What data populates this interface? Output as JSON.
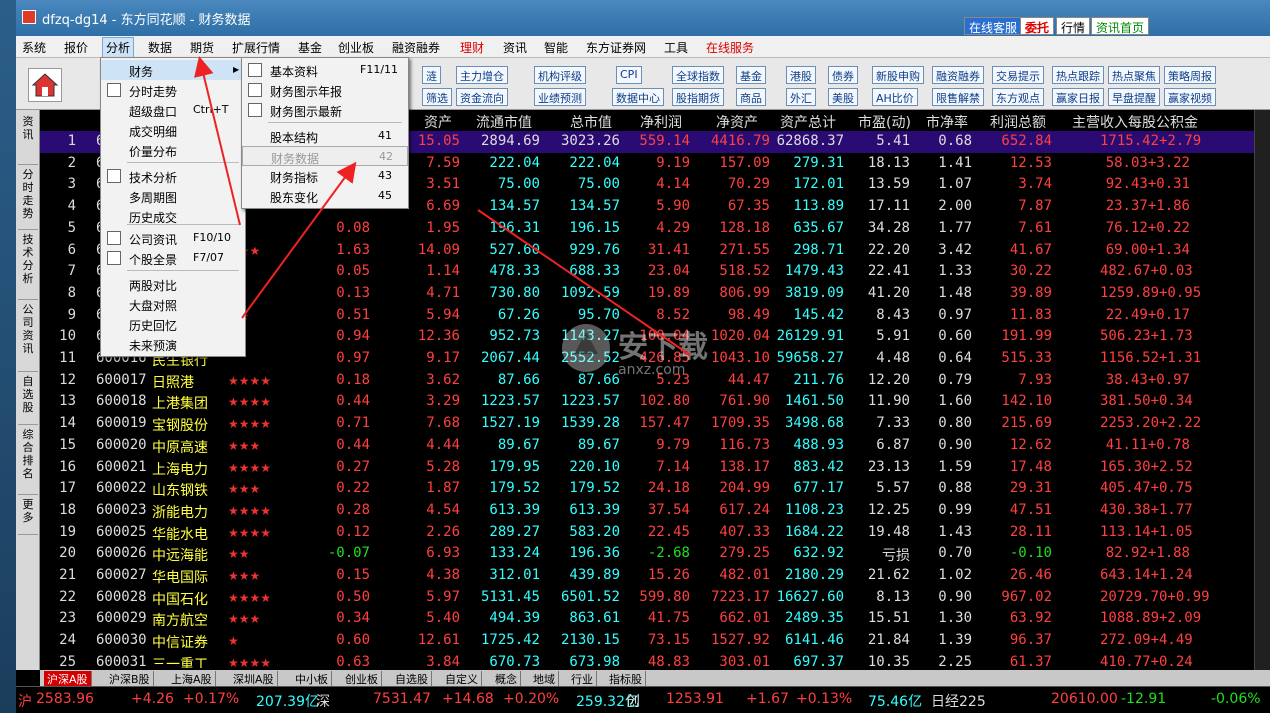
{
  "window": {
    "title": "dfzq-dg14 - 东方同花顺 - 财务数据"
  },
  "titlebar_buttons": {
    "kefu": "在线客服",
    "weituo": "委托",
    "hangqing": "行情",
    "home": "资讯首页"
  },
  "menubar": {
    "items": [
      "系统",
      "报价",
      "分析",
      "数据",
      "期货",
      "扩展行情",
      "基金",
      "创业板",
      "融资融券",
      "理财",
      "资讯",
      "智能",
      "东方证券网",
      "工具",
      "在线服务"
    ]
  },
  "toolbar": {
    "btns": [
      "涟",
      "筛选",
      "主力增仓",
      "机构评级",
      "CPI",
      "数据中心",
      "全球指数",
      "基金",
      "港股",
      "债券",
      "新股申购",
      "融资融券",
      "交易提示",
      "热点跟踪",
      "热点聚焦",
      "策略周报",
      "资金流向",
      "业绩预测",
      "股指期货",
      "商品",
      "外汇",
      "美股",
      "AH比价",
      "限售解禁",
      "东方观点",
      "赢家日报",
      "早盘提醒",
      "赢家视频"
    ]
  },
  "vtabs": [
    "资讯",
    "分时走势",
    "技术分析",
    "公司资讯",
    "自选股",
    "综合排名",
    "更多"
  ],
  "table": {
    "headers": [
      "代",
      "资产",
      "流通市值",
      "总市值",
      "净利润",
      "净资产",
      "资产总计",
      "市盈(动)",
      "市净率",
      "利润总额",
      "主营收入每股公积金"
    ],
    "rows": [
      [
        "1",
        "600",
        "",
        "",
        "15.05",
        "2894.69",
        "3023.26",
        "559.14",
        "4416.79",
        "62868.37",
        "5.41",
        "0.68",
        "652.84",
        "1715.42+2.79"
      ],
      [
        "2",
        "600",
        "",
        "",
        "7.59",
        "222.04",
        "222.04",
        "9.19",
        "157.09",
        "279.31",
        "18.13",
        "1.41",
        "12.53",
        "58.03+3.22"
      ],
      [
        "3",
        "600",
        "",
        "",
        "3.51",
        "75.00",
        "75.00",
        "4.14",
        "70.29",
        "172.01",
        "13.59",
        "1.07",
        "3.74",
        "92.43+0.31"
      ],
      [
        "4",
        "600",
        "",
        "",
        "6.69",
        "134.57",
        "134.57",
        "5.90",
        "67.35",
        "113.89",
        "17.11",
        "2.00",
        "7.87",
        "23.37+1.86"
      ],
      [
        "5",
        "600",
        "",
        "0.08",
        "1.95",
        "196.31",
        "196.15",
        "4.29",
        "128.18",
        "635.67",
        "34.28",
        "1.77",
        "7.61",
        "76.12+0.22"
      ],
      [
        "6",
        "600",
        "★★★",
        "1.63",
        "14.09",
        "527.60",
        "929.76",
        "31.41",
        "271.55",
        "298.71",
        "22.20",
        "3.42",
        "41.67",
        "69.00+1.34"
      ],
      [
        "7",
        "600",
        "★",
        "0.05",
        "1.14",
        "478.33",
        "688.33",
        "23.04",
        "518.52",
        "1479.43",
        "22.41",
        "1.33",
        "30.22",
        "482.67+0.03"
      ],
      [
        "8",
        "600",
        "",
        "0.13",
        "4.71",
        "730.80",
        "1092.59",
        "19.89",
        "806.99",
        "3819.09",
        "41.20",
        "1.48",
        "39.89",
        "1259.89+0.95"
      ],
      [
        "9",
        "600",
        "★★",
        "0.51",
        "5.94",
        "67.26",
        "95.70",
        "8.52",
        "98.49",
        "145.42",
        "8.43",
        "0.97",
        "11.83",
        "22.49+0.17"
      ],
      [
        "10",
        "600",
        "",
        "0.94",
        "12.36",
        "952.73",
        "1143.27",
        "100.04",
        "1020.04",
        "26129.91",
        "5.91",
        "0.60",
        "191.99",
        "506.23+1.73"
      ],
      [
        "11",
        "600016",
        "民生银行",
        "0.97",
        "9.17",
        "2067.44",
        "2552.52",
        "426.85",
        "1043.10",
        "59658.27",
        "4.48",
        "0.64",
        "515.33",
        "1156.52+1.31"
      ],
      [
        "12",
        "600017",
        "日照港",
        "0.18",
        "3.62",
        "87.66",
        "87.66",
        "5.23",
        "44.47",
        "211.76",
        "12.20",
        "0.79",
        "7.93",
        "38.43+0.97"
      ],
      [
        "13",
        "600018",
        "上港集团",
        "0.44",
        "3.29",
        "1223.57",
        "1223.57",
        "102.80",
        "761.90",
        "1461.50",
        "11.90",
        "1.60",
        "142.10",
        "381.50+0.34"
      ],
      [
        "14",
        "600019",
        "宝钢股份",
        "0.71",
        "7.68",
        "1527.19",
        "1539.28",
        "157.47",
        "1709.35",
        "3498.68",
        "7.33",
        "0.80",
        "215.69",
        "2253.20+2.22"
      ],
      [
        "15",
        "600020",
        "中原高速",
        "0.44",
        "4.44",
        "89.67",
        "89.67",
        "9.79",
        "116.73",
        "488.93",
        "6.87",
        "0.90",
        "12.62",
        "41.11+0.78"
      ],
      [
        "16",
        "600021",
        "上海电力",
        "0.27",
        "5.28",
        "179.95",
        "220.10",
        "7.14",
        "138.17",
        "883.42",
        "23.13",
        "1.59",
        "17.48",
        "165.30+2.52"
      ],
      [
        "17",
        "600022",
        "山东钢铁",
        "0.22",
        "1.87",
        "179.52",
        "179.52",
        "24.18",
        "204.99",
        "677.17",
        "5.57",
        "0.88",
        "29.31",
        "405.47+0.75"
      ],
      [
        "18",
        "600023",
        "浙能电力",
        "0.28",
        "4.54",
        "613.39",
        "613.39",
        "37.54",
        "617.24",
        "1108.23",
        "12.25",
        "0.99",
        "47.51",
        "430.38+1.77"
      ],
      [
        "19",
        "600025",
        "华能水电",
        "0.12",
        "2.26",
        "289.27",
        "583.20",
        "22.45",
        "407.33",
        "1684.22",
        "19.48",
        "1.43",
        "28.11",
        "113.14+1.05"
      ],
      [
        "20",
        "600026",
        "中远海能",
        "-0.07",
        "6.93",
        "133.24",
        "196.36",
        "-2.68",
        "279.25",
        "632.92",
        "亏损",
        "0.70",
        "-0.10",
        "82.92+1.88"
      ],
      [
        "21",
        "600027",
        "华电国际",
        "0.15",
        "4.38",
        "312.01",
        "439.89",
        "15.26",
        "482.01",
        "2180.29",
        "21.62",
        "1.02",
        "26.46",
        "643.14+1.24"
      ],
      [
        "22",
        "600028",
        "中国石化",
        "0.50",
        "5.97",
        "5131.45",
        "6501.52",
        "599.80",
        "7223.17",
        "16627.60",
        "8.13",
        "0.90",
        "967.02",
        "20729.70+0.99"
      ],
      [
        "23",
        "600029",
        "南方航空",
        "0.34",
        "5.40",
        "494.39",
        "863.61",
        "41.75",
        "662.01",
        "2489.35",
        "15.51",
        "1.30",
        "63.92",
        "1088.89+2.09"
      ],
      [
        "24",
        "600030",
        "中信证券",
        "0.60",
        "12.61",
        "1725.42",
        "2130.15",
        "73.15",
        "1527.92",
        "6141.46",
        "21.84",
        "1.39",
        "96.37",
        "272.09+4.49"
      ],
      [
        "25",
        "600031",
        "三一重工",
        "0.63",
        "3.84",
        "670.73",
        "673.98",
        "48.83",
        "303.01",
        "697.37",
        "10.35",
        "2.25",
        "61.37",
        "410.77+0.24"
      ]
    ],
    "stars": [
      "",
      "",
      "",
      "",
      "",
      "★★★",
      "★",
      "",
      "★★",
      "",
      "",
      "★★★★",
      "★★★★",
      "★★★★",
      "★★★",
      "★★★★",
      "★★★",
      "★★★★",
      "★★★★",
      "★★",
      "★★★",
      "★★★★",
      "★★★",
      "★",
      "★★★★"
    ]
  },
  "bottom_tabs": [
    "沪深A股",
    "沪深B股",
    "上海A股",
    "深圳A股",
    "中小板",
    "创业板",
    "自选股",
    "自定义",
    "概念",
    "地域",
    "行业",
    "指标股"
  ],
  "status": {
    "sh_label": "沪",
    "sh_val": "2583.96",
    "sh_chg": "+4.26",
    "sh_pct": "+0.17%",
    "sh_amt": "207.39亿",
    "sz_label": "深",
    "sz_val": "7531.47",
    "sz_chg": "+14.68",
    "sz_pct": "+0.20%",
    "sz_amt": "259.32亿",
    "cy_label": "创",
    "cy_val": "1253.91",
    "cy_chg": "+1.67",
    "cy_pct": "+0.13%",
    "cy_amt": "75.46亿",
    "rj_label": "日经225",
    "rj_val": "20610.00",
    "rj_chg": "-12.91",
    "rj_pct": "-0.06%"
  },
  "menu_analysis": {
    "items": [
      {
        "label": "财务",
        "sc": "",
        "hl": true
      },
      {
        "label": "分时走势",
        "sc": ""
      },
      {
        "label": "超级盘口",
        "sc": "Ctrl+T"
      },
      {
        "label": "成交明细",
        "sc": ""
      },
      {
        "label": "价量分布",
        "sc": ""
      },
      {
        "label": "技术分析",
        "sc": ""
      },
      {
        "label": "多周期图",
        "sc": ""
      },
      {
        "label": "历史成交",
        "sc": ""
      },
      {
        "label": "公司资讯",
        "sc": "F10/10"
      },
      {
        "label": "个股全景",
        "sc": "F7/07"
      },
      {
        "label": "两股对比",
        "sc": ""
      },
      {
        "label": "大盘对照",
        "sc": ""
      },
      {
        "label": "历史回忆",
        "sc": ""
      },
      {
        "label": "未来预演",
        "sc": ""
      }
    ]
  },
  "menu_finance": {
    "items": [
      {
        "label": "基本资料",
        "sc": "F11/11"
      },
      {
        "label": "财务图示年报",
        "sc": ""
      },
      {
        "label": "财务图示最新",
        "sc": ""
      },
      {
        "label": "股本结构",
        "sc": "41"
      },
      {
        "label": "财务数据",
        "sc": "42",
        "dis": true
      },
      {
        "label": "财务指标",
        "sc": "43"
      },
      {
        "label": "股东变化",
        "sc": "45"
      }
    ]
  },
  "watermark": {
    "text": "安下载",
    "sub": "anxz.com"
  }
}
